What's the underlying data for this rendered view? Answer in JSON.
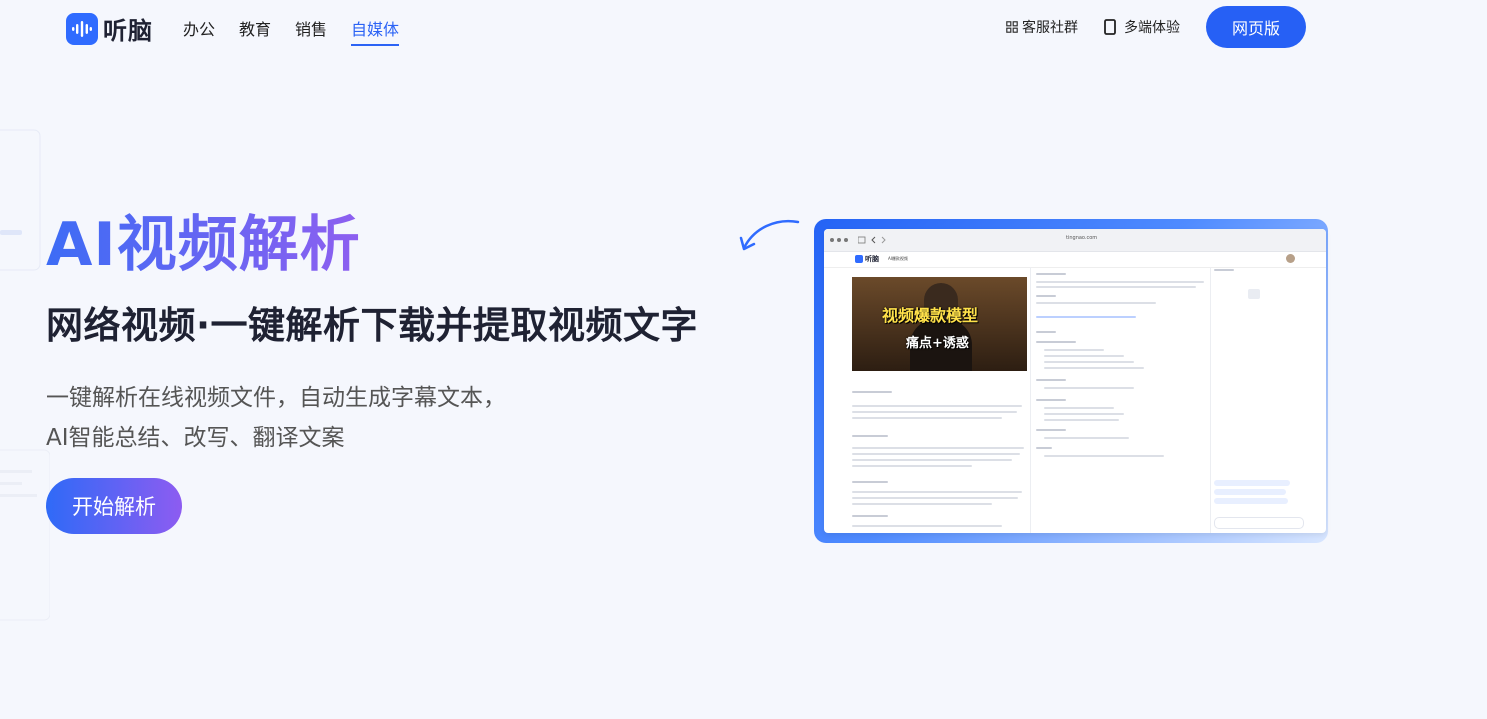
{
  "header": {
    "logo_text": "听脑",
    "nav": [
      {
        "label": "办公"
      },
      {
        "label": "教育"
      },
      {
        "label": "销售"
      },
      {
        "label": "自媒体",
        "active": true
      }
    ],
    "service_group": "客服社群",
    "multi_device": "多端体验",
    "web_version": "网页版"
  },
  "hero": {
    "title": "AI视频解析",
    "subtitle": "网络视频·一键解析下载并提取视频文字",
    "desc_line1": "一键解析在线视频文件，自动生成字幕文本，",
    "desc_line2": "AI智能总结、改写、翻译文案",
    "start_button": "开始解析"
  },
  "preview": {
    "url": "tingnao.com",
    "app_logo": "听脑",
    "doc_title": "AI爆款视频",
    "video_caption_1": "视频爆款模型",
    "video_caption_2": "痛点+诱惑"
  },
  "colors": {
    "primary": "#2660f5",
    "gradient_start": "#3d6cf5",
    "gradient_end": "#8e5ff0",
    "background": "#f5f7fd"
  },
  "icons": {
    "logo": "soundwave-icon",
    "service_group": "grid-icon",
    "multi_device": "phone-icon",
    "arrow": "curved-arrow-icon"
  }
}
